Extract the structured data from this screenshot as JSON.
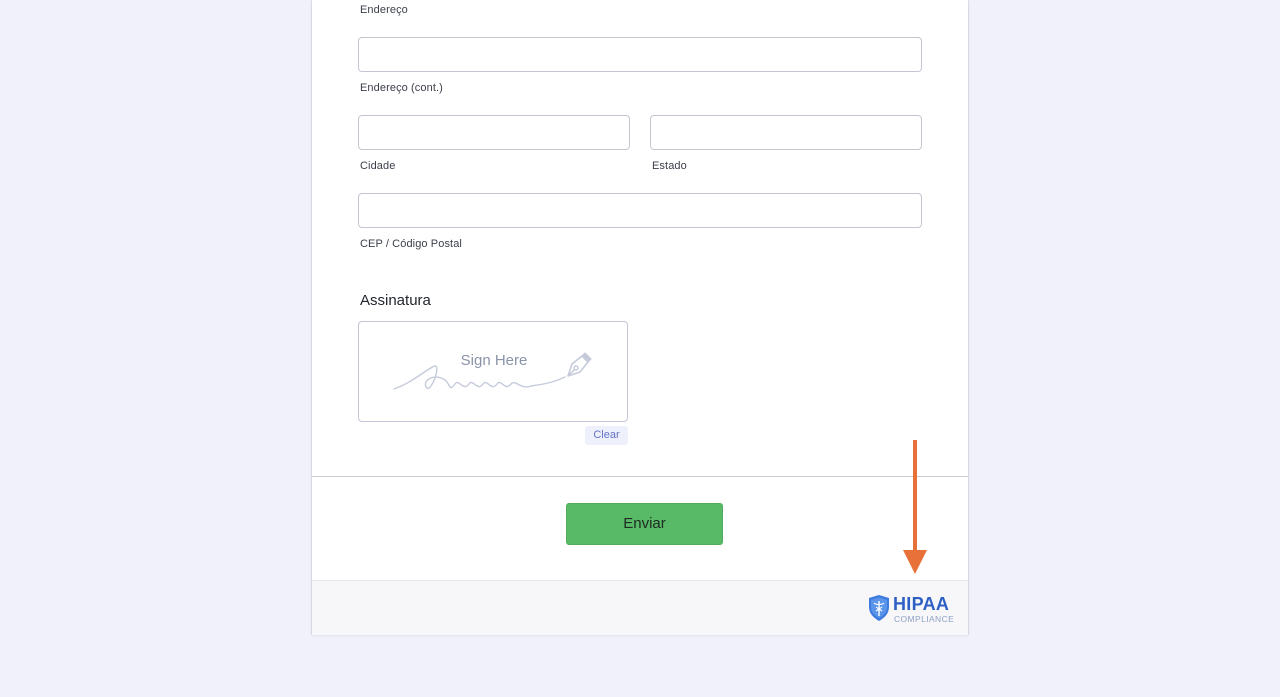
{
  "form": {
    "address": {
      "street_label": "Endereço",
      "street2_value": "",
      "street2_label": "Endereço (cont.)",
      "city_value": "",
      "city_label": "Cidade",
      "state_value": "",
      "state_label": "Estado",
      "zip_value": "",
      "zip_label": "CEP / Código Postal"
    },
    "signature": {
      "title": "Assinatura",
      "placeholder": "Sign Here",
      "clear_label": "Clear"
    },
    "submit_label": "Enviar"
  },
  "footer": {
    "badge_title": "HIPAA",
    "badge_subtitle": "COMPLIANCE"
  },
  "colors": {
    "page_background": "#f1f1fb",
    "submit_button": "#58ba67",
    "hipaa_blue": "#2e5fc4",
    "annotation_arrow": "#e8713a"
  },
  "icons": {
    "signature": "pen-nib-icon",
    "badge": "caduceus-shield-icon",
    "annotation": "arrow-down-icon"
  }
}
